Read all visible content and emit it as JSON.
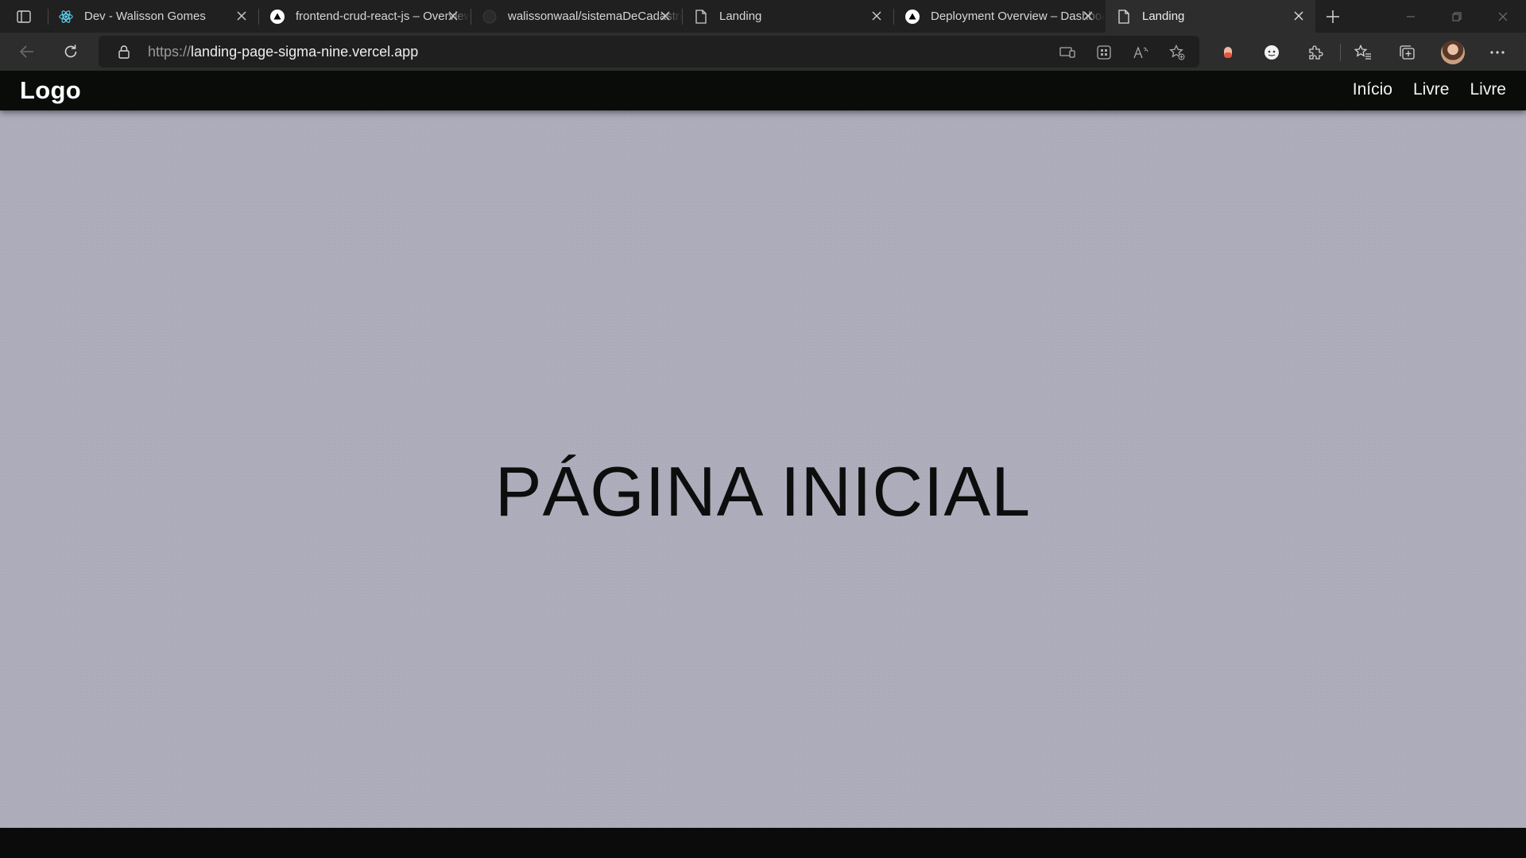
{
  "browser": {
    "tabs": [
      {
        "title": "Dev - Walisson Gomes",
        "icon": "react-icon",
        "active": false
      },
      {
        "title": "frontend-crud-react-js – Overview – Vercel",
        "icon": "vercel-icon",
        "active": false
      },
      {
        "title": "walissonwaal/sistemaDeCadastro",
        "icon": "github-icon",
        "active": false
      },
      {
        "title": "Landing",
        "icon": "page-icon",
        "active": false
      },
      {
        "title": "Deployment Overview – Dashboard – Vercel",
        "icon": "vercel-icon",
        "active": false
      },
      {
        "title": "Landing",
        "icon": "page-icon",
        "active": true
      }
    ],
    "address_bar": {
      "scheme": "https://",
      "host": "landing-page-sigma-nine.vercel.app"
    }
  },
  "site": {
    "logo": "Logo",
    "nav": [
      "Início",
      "Livre",
      "Livre"
    ],
    "hero_title": "PÁGINA INICIAL"
  },
  "colors": {
    "page_background": "#aeadbc",
    "header_background": "#0a0c0a",
    "hero_text": "#0d0d0d"
  }
}
